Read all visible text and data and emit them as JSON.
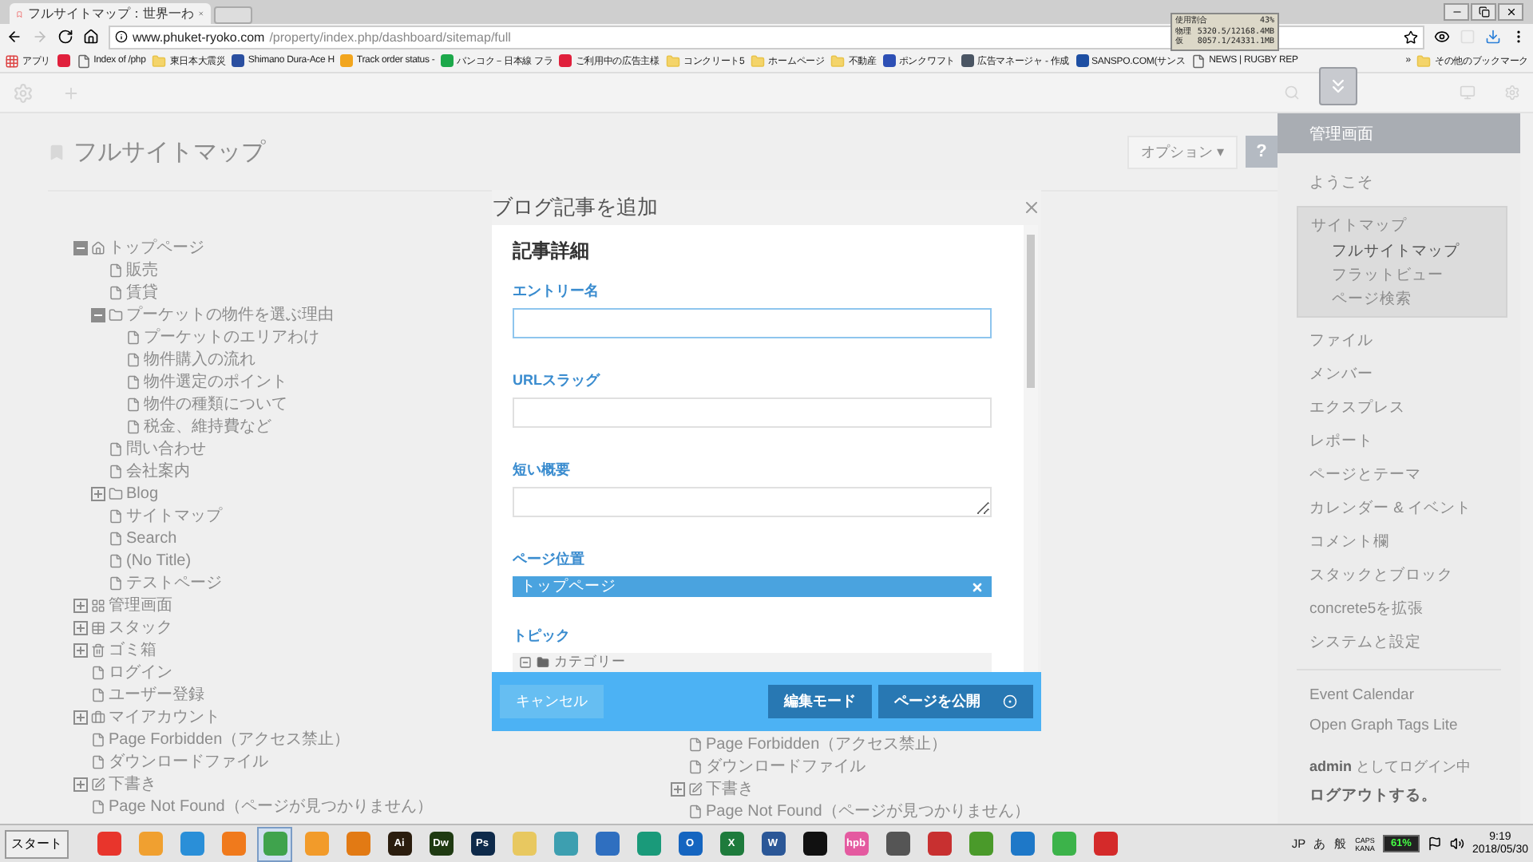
{
  "browser": {
    "tab_title": "フルサイトマップ：世界一わ",
    "url_host": "www.phuket-ryoko.com",
    "url_path": "/property/index.php/dashboard/sitemap/full",
    "bookmarks": [
      {
        "kind": "apps",
        "label": "アプリ"
      },
      {
        "kind": "site",
        "color": "#e0203c"
      },
      {
        "kind": "page",
        "label": "Index of /php"
      },
      {
        "kind": "folder",
        "label": "東日本大震災"
      },
      {
        "kind": "site",
        "color": "#2a4fa0",
        "label": "Shimano Dura-Ace H"
      },
      {
        "kind": "site",
        "color": "#f2a51d",
        "label": "Track order status -"
      },
      {
        "kind": "site",
        "color": "#1ca84a",
        "label": "バンコク－日本線 フラ"
      },
      {
        "kind": "site",
        "color": "#e0203c",
        "label": "ご利用中の広告主様"
      },
      {
        "kind": "folder",
        "label": "コンクリート5"
      },
      {
        "kind": "folder",
        "label": "ホームページ"
      },
      {
        "kind": "folder",
        "label": "不動産"
      },
      {
        "kind": "site",
        "color": "#2d4fb5",
        "label": "ポンクワフト"
      },
      {
        "kind": "site",
        "color": "#4a5563",
        "label": "広告マネージャ - 作成"
      },
      {
        "kind": "site",
        "color": "#1e4fa3",
        "label": "SANSPO.COM(サンス"
      },
      {
        "kind": "page",
        "label": "NEWS | RUGBY REP"
      }
    ],
    "bookmarks_overflow": "»",
    "other_bookmarks": "その他のブックマーク"
  },
  "memory_monitor": [
    {
      "label": "使用割合",
      "value": "43%"
    },
    {
      "label": "物理",
      "value": "5320.5/12168.4MB"
    },
    {
      "label": "仮",
      "value": "8057.1/24331.1MB"
    }
  ],
  "page": {
    "title": "フルサイトマップ",
    "options_button": "オプション ▾",
    "help_button": "?",
    "tree": [
      {
        "label": "トップページ",
        "kind": "home",
        "expanded": true,
        "children": [
          {
            "label": "販売",
            "kind": "page"
          },
          {
            "label": "賃貸",
            "kind": "page"
          },
          {
            "label": "プーケットの物件を選ぶ理由",
            "kind": "folder",
            "expanded": true,
            "children": [
              {
                "label": "プーケットのエリアわけ",
                "kind": "page"
              },
              {
                "label": "物件購入の流れ",
                "kind": "page"
              },
              {
                "label": "物件選定のポイント",
                "kind": "page"
              },
              {
                "label": "物件の種類について",
                "kind": "page"
              },
              {
                "label": "税金、維持費など",
                "kind": "page"
              }
            ]
          },
          {
            "label": "問い合わせ",
            "kind": "page"
          },
          {
            "label": "会社案内",
            "kind": "page"
          },
          {
            "label": "Blog",
            "kind": "folder",
            "expanded": false
          },
          {
            "label": "サイトマップ",
            "kind": "page"
          },
          {
            "label": "Search",
            "kind": "page"
          },
          {
            "label": "(No Title)",
            "kind": "page"
          },
          {
            "label": "テストページ",
            "kind": "page"
          }
        ]
      },
      {
        "label": "管理画面",
        "kind": "grid",
        "expanded": false
      },
      {
        "label": "スタック",
        "kind": "table",
        "expanded": false
      },
      {
        "label": "ゴミ箱",
        "kind": "trash",
        "expanded": false
      },
      {
        "label": "ログイン",
        "kind": "page"
      },
      {
        "label": "ユーザー登録",
        "kind": "page"
      },
      {
        "label": "マイアカウント",
        "kind": "briefcase",
        "expanded": false
      },
      {
        "label": "Page Forbidden（アクセス禁止）",
        "kind": "page"
      },
      {
        "label": "ダウンロードファイル",
        "kind": "page"
      },
      {
        "label": "下書き",
        "kind": "edit",
        "expanded": false
      },
      {
        "label": "Page Not Found（ページが見つかりません）",
        "kind": "page"
      }
    ],
    "second_column": [
      {
        "label": "Page Forbidden（アクセス禁止）",
        "kind": "page"
      },
      {
        "label": "ダウンロードファイル",
        "kind": "page"
      },
      {
        "label": "下書き",
        "kind": "edit",
        "expanded": false
      },
      {
        "label": "Page Not Found（ページが見つかりません）",
        "kind": "page"
      }
    ]
  },
  "sidebar": {
    "header": "管理画面",
    "items": [
      {
        "label": "ようこそ",
        "selected": false
      },
      {
        "label": "サイトマップ",
        "selected": true,
        "children": [
          {
            "label": "フルサイトマップ",
            "selected": true
          },
          {
            "label": "フラットビュー",
            "selected": false
          },
          {
            "label": "ページ検索",
            "selected": false
          }
        ]
      },
      {
        "label": "ファイル",
        "selected": false
      },
      {
        "label": "メンバー",
        "selected": false
      },
      {
        "label": "エクスプレス",
        "selected": false
      },
      {
        "label": "レポート",
        "selected": false
      },
      {
        "label": "ページとテーマ",
        "selected": false
      },
      {
        "label": "カレンダー & イベント",
        "selected": false
      },
      {
        "label": "コメント欄",
        "selected": false
      },
      {
        "label": "スタックとブロック",
        "selected": false
      },
      {
        "label": "concrete5を拡張",
        "selected": false
      },
      {
        "label": "システムと設定",
        "selected": false
      }
    ],
    "extra_items": [
      {
        "label": "Event Calendar"
      },
      {
        "label": "Open Graph Tags Lite"
      }
    ],
    "login_status": "**admin** としてログイン中",
    "logout": "ログアウトする。"
  },
  "dialog": {
    "title": "ブログ記事を追加",
    "section": "記事詳細",
    "fields": [
      {
        "kind": "text",
        "label": "エントリー名",
        "focused": true
      },
      {
        "kind": "text",
        "label": "URLスラッグ",
        "focused": false
      },
      {
        "kind": "textarea",
        "label": "短い概要",
        "focused": false
      },
      {
        "kind": "page_selector",
        "label": "ページ位置",
        "value": "トップページ"
      },
      {
        "kind": "topic_tree",
        "label": "トピック",
        "value": "カテゴリー"
      }
    ],
    "cancel": "キャンセル",
    "edit_mode": "編集モード",
    "publish": "ページを公開"
  },
  "taskbar": {
    "start": "スタート",
    "apps": [
      {
        "color": "#e8352c",
        "active": false
      },
      {
        "color": "#f0a030",
        "active": false
      },
      {
        "color": "#2a8fd8",
        "active": false
      },
      {
        "color": "#f07a1c",
        "active": false
      },
      {
        "color": "#3fa34d",
        "active": true
      },
      {
        "color": "#f29b2a",
        "active": false
      },
      {
        "color": "#e27a14",
        "active": false
      },
      {
        "color": "#2b1d0e",
        "label": "Ai",
        "active": false
      },
      {
        "color": "#1f3a12",
        "label": "Dw",
        "active": false
      },
      {
        "color": "#0e2a4a",
        "label": "Ps",
        "active": false
      },
      {
        "color": "#e8c860",
        "active": false
      },
      {
        "color": "#3d9fb0",
        "active": false
      },
      {
        "color": "#2f6fc0",
        "active": false
      },
      {
        "color": "#1a9a7a",
        "active": false
      },
      {
        "color": "#1565c0",
        "label": "O",
        "active": false
      },
      {
        "color": "#1e7b3c",
        "label": "X",
        "active": false
      },
      {
        "color": "#2b5797",
        "label": "W",
        "active": false
      },
      {
        "color": "#111111",
        "active": false
      },
      {
        "color": "#e45aa0",
        "label": "hpb",
        "active": false
      },
      {
        "color": "#555555",
        "active": false
      },
      {
        "color": "#c83030",
        "active": false
      },
      {
        "color": "#4a9a2a",
        "active": false
      },
      {
        "color": "#1e78c8",
        "active": false
      },
      {
        "color": "#3cb34a",
        "active": false
      },
      {
        "color": "#d42a2a",
        "active": false
      }
    ],
    "tray": [
      "JP",
      "あ",
      "般"
    ],
    "caps": "CAPS",
    "kana": "KANA",
    "battery": "61%",
    "time": "9:19",
    "date": "2018/05/30"
  }
}
